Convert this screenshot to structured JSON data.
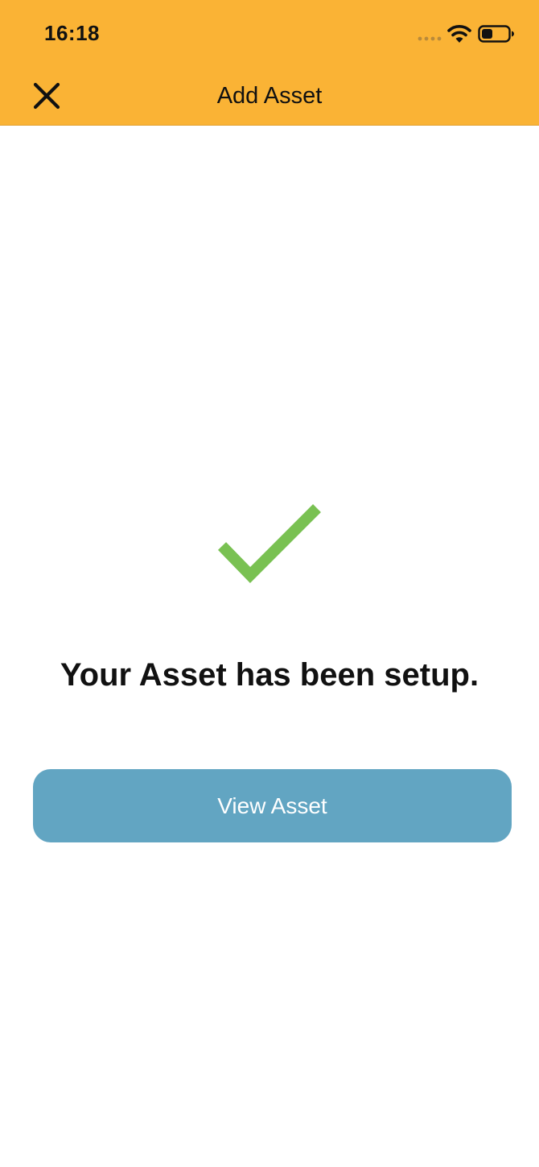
{
  "status_bar": {
    "time": "16:18"
  },
  "header": {
    "title": "Add Asset",
    "close_icon": "close-icon",
    "background_color": "#FAB335"
  },
  "success": {
    "icon": "checkmark-icon",
    "icon_color": "#79C152",
    "message": "Your Asset has been setup."
  },
  "actions": {
    "view_asset_label": "View Asset",
    "button_color": "#62A5C2"
  }
}
